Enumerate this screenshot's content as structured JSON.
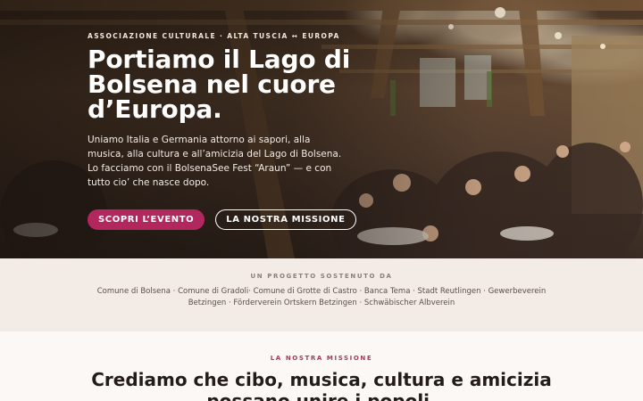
{
  "hero": {
    "eyebrow": "ASSOCIAZIONE CULTURALE · ALTA TUSCIA ↔ EUROPA",
    "title": "Portiamo il Lago di Bolsena nel cuore d’Europa.",
    "text": "Uniamo Italia e Germania attorno ai sapori, alla musica, alla cultura e all’amicizia del Lago di Bolsena. Lo facciamo con il BolsenaSee Fest “Araun” — e con tutto cio’ che nasce dopo.",
    "primary_button": "SCOPRI L’EVENTO",
    "secondary_button": "LA NOSTRA MISSIONE"
  },
  "support": {
    "label": "UN PROGETTO SOSTENUTO DA",
    "list": "Comune di Bolsena · Comune di Gradoli· Comune di Grotte di Castro · Banca Tema · Stadt Reutlingen · Gewerbeverein Betzingen · Förderverein Ortskern Betzingen · Schwäbischer Albverein"
  },
  "mission": {
    "label": "LA NOSTRA MISSIONE",
    "title": "Crediamo che cibo, musica, cultura e amicizia possano unire i popoli."
  },
  "colors": {
    "accent": "#b2285e",
    "mission_label": "#a63a5a",
    "support_bg": "#f3ebe5"
  }
}
